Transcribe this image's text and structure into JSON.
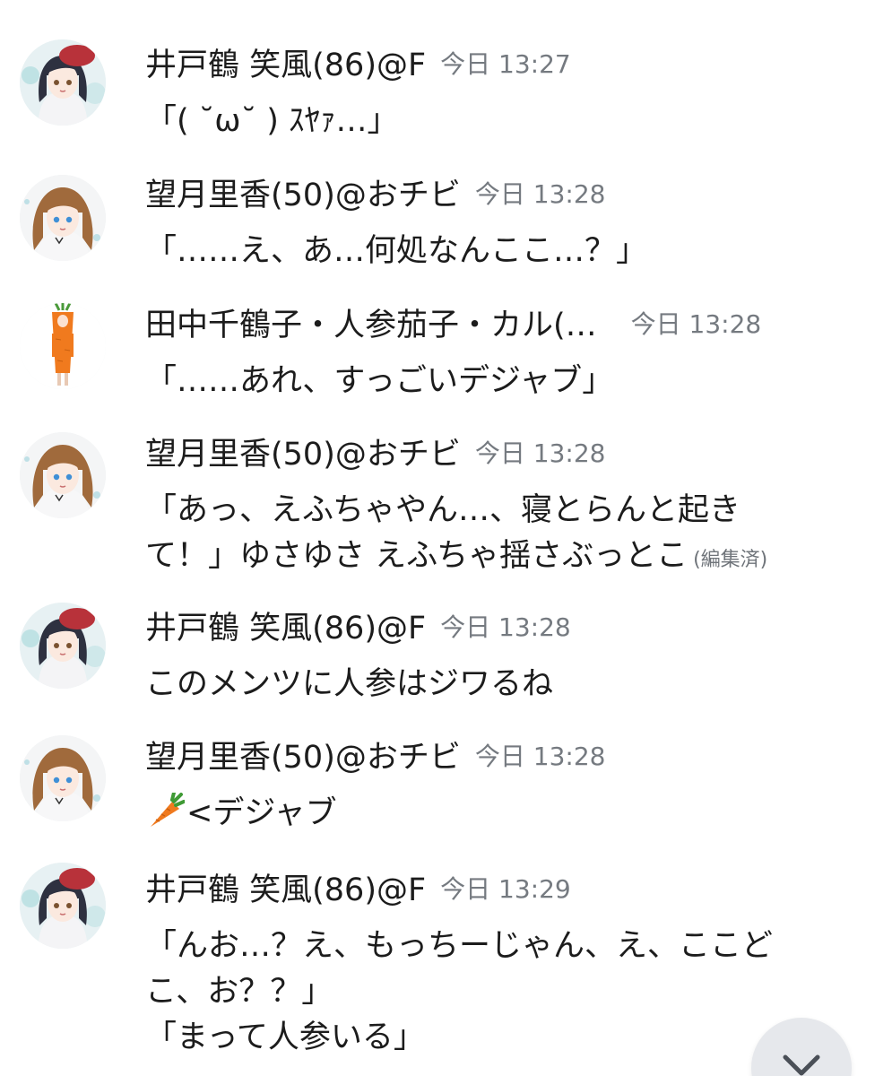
{
  "messages": [
    {
      "username": "井戸鶴 笑風(86)@F",
      "timestamp": "今日 13:27",
      "lines": [
        "「( ˘ω˘ ) ｽﾔｧ…」"
      ],
      "edited": "",
      "avatar": "dark-hair-red-beret-avatar"
    },
    {
      "username": "望月里香(50)@おチビ",
      "timestamp": "今日 13:28",
      "lines": [
        "「……え、あ…何処なんここ…？」"
      ],
      "edited": "",
      "avatar": "brown-hair-girl-avatar"
    },
    {
      "username": "田中千鶴子・人参茄子・カル(…",
      "timestamp": "今日 13:28",
      "lines": [
        "「……あれ、すっごいデジャブ」"
      ],
      "edited": "",
      "avatar": "carrot-costume-avatar"
    },
    {
      "username": "望月里香(50)@おチビ",
      "timestamp": "今日 13:28",
      "lines": [
        "「あっ、えふちゃやん…、寝とらんと起き",
        "て！」ゆさゆさ えふちゃ揺さぶっとこ"
      ],
      "edited": "(編集済)",
      "avatar": "brown-hair-girl-avatar"
    },
    {
      "username": "井戸鶴 笑風(86)@F",
      "timestamp": "今日 13:28",
      "lines": [
        "このメンツに人参はジワるね"
      ],
      "edited": "",
      "avatar": "dark-hair-red-beret-avatar"
    },
    {
      "username": "望月里香(50)@おチビ",
      "timestamp": "今日 13:28",
      "lines": [
        "<デジャブ"
      ],
      "edited": "",
      "emoji": "carrot-emoji",
      "avatar": "brown-hair-girl-avatar"
    },
    {
      "username": "井戸鶴 笑風(86)@F",
      "timestamp": "今日 13:29",
      "lines": [
        "「んお…？え、もっちーじゃん、え、ここど",
        "こ、お？？」",
        "「まって人参いる」"
      ],
      "edited": "",
      "avatar": "dark-hair-red-beret-avatar"
    }
  ],
  "controls": {
    "scroll_down_icon": "chevron-down-icon"
  },
  "colors": {
    "text": "#1c1c1c",
    "timestamp": "#757a80",
    "scroll_button": "#e6e8ec",
    "carrot": "#f07a1e",
    "beret": "#b8323a"
  }
}
